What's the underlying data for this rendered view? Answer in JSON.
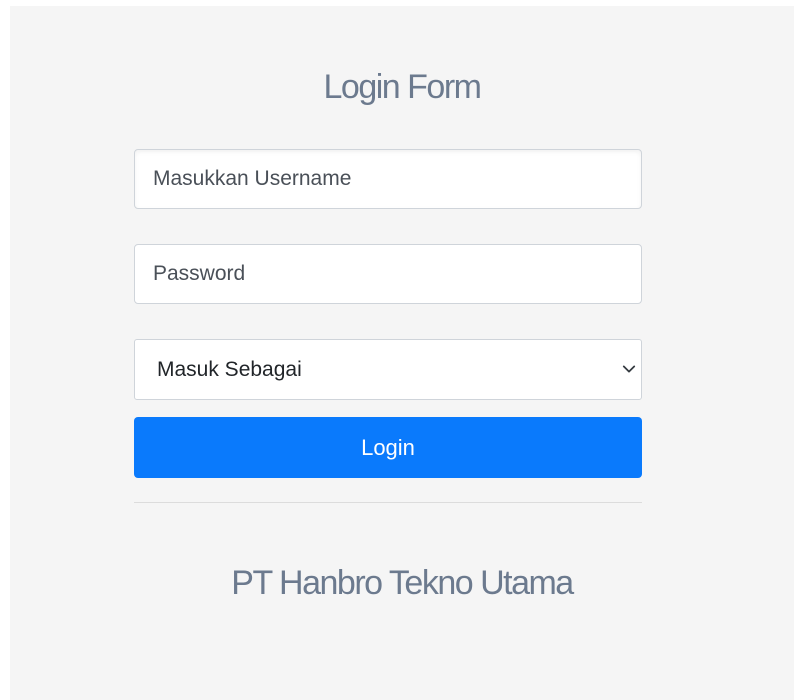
{
  "form": {
    "title": "Login Form",
    "username_placeholder": "Masukkan Username",
    "password_placeholder": "Password",
    "role_select": {
      "selected": "Masuk Sebagai",
      "options": [
        "Masuk Sebagai"
      ]
    },
    "login_label": "Login"
  },
  "footer": {
    "company_name": "PT Hanbro Tekno Utama"
  },
  "colors": {
    "background": "#f5f5f5",
    "title": "#6c7a8e",
    "primary_button": "#0a7afc"
  },
  "icons": {
    "select_chevron": "chevron-down-icon"
  }
}
